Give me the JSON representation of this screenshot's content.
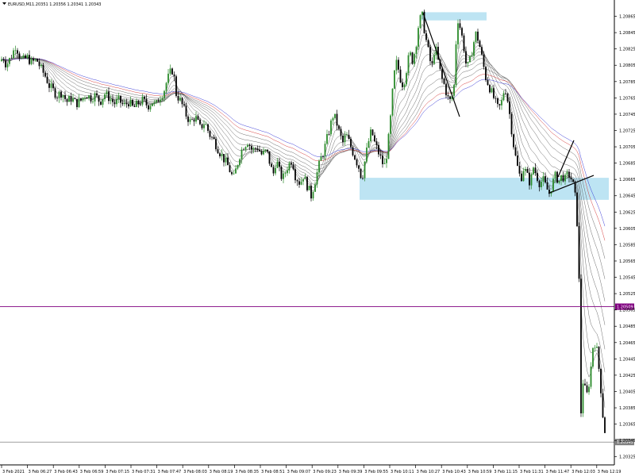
{
  "header": {
    "symbol": "EURUSD,M1",
    "ohlc": "1.20351 1.20356 1.20341 1.20343"
  },
  "chart_data": {
    "type": "candlestick",
    "symbol": "EURUSD",
    "timeframe": "M1",
    "ylim": [
      1.20315,
      1.20885
    ],
    "y_ticks": [
      "1.20865",
      "1.20845",
      "1.20825",
      "1.20805",
      "1.20785",
      "1.20765",
      "1.20745",
      "1.20725",
      "1.20705",
      "1.20685",
      "1.20665",
      "1.20645",
      "1.20625",
      "1.20605",
      "1.20585",
      "1.20565",
      "1.20545",
      "1.20525",
      "1.20505",
      "1.20485",
      "1.20465",
      "1.20445",
      "1.20425",
      "1.20405",
      "1.20385",
      "1.20365",
      "1.20345",
      "1.20325"
    ],
    "x_ticks": [
      "3 Feb 2021",
      "3 Feb 06:27",
      "3 Feb 06:43",
      "3 Feb 06:59",
      "3 Feb 07:15",
      "3 Feb 07:31",
      "3 Feb 07:47",
      "3 Feb 08:03",
      "3 Feb 08:19",
      "3 Feb 08:35",
      "3 Feb 08:51",
      "3 Feb 09:07",
      "3 Feb 09:23",
      "3 Feb 09:39",
      "3 Feb 09:55",
      "3 Feb 10:11",
      "3 Feb 10:27",
      "3 Feb 10:43",
      "3 Feb 10:59",
      "3 Feb 11:15",
      "3 Feb 11:31",
      "3 Feb 11:47",
      "3 Feb 12:03",
      "3 Feb 12:19"
    ],
    "price_path": [
      [
        0,
        1.2081
      ],
      [
        4,
        1.20815
      ],
      [
        8,
        1.20805
      ],
      [
        12,
        1.20812
      ],
      [
        16,
        1.2082
      ],
      [
        20,
        1.2083
      ],
      [
        24,
        1.20818
      ],
      [
        28,
        1.2081
      ],
      [
        34,
        1.20815
      ],
      [
        40,
        1.20808
      ],
      [
        46,
        1.20812
      ],
      [
        52,
        1.208
      ],
      [
        58,
        1.2079
      ],
      [
        62,
        1.2078
      ],
      [
        66,
        1.20775
      ],
      [
        72,
        1.20768
      ],
      [
        78,
        1.20772
      ],
      [
        84,
        1.2076
      ],
      [
        90,
        1.20765
      ],
      [
        96,
        1.20758
      ],
      [
        102,
        1.20762
      ],
      [
        108,
        1.2077
      ],
      [
        114,
        1.20765
      ],
      [
        120,
        1.20768
      ],
      [
        126,
        1.2076
      ],
      [
        132,
        1.2077
      ],
      [
        138,
        1.20765
      ],
      [
        144,
        1.20758
      ],
      [
        150,
        1.20762
      ],
      [
        156,
        1.20755
      ],
      [
        162,
        1.2076
      ],
      [
        168,
        1.20752
      ],
      [
        174,
        1.20758
      ],
      [
        180,
        1.20762
      ],
      [
        186,
        1.20755
      ],
      [
        192,
        1.2076
      ],
      [
        196,
        1.20755
      ],
      [
        200,
        1.20765
      ],
      [
        206,
        1.20772
      ],
      [
        210,
        1.20785
      ],
      [
        214,
        1.20795
      ],
      [
        218,
        1.208
      ],
      [
        222,
        1.2077
      ],
      [
        228,
        1.2076
      ],
      [
        234,
        1.20745
      ],
      [
        240,
        1.20735
      ],
      [
        246,
        1.20742
      ],
      [
        252,
        1.20728
      ],
      [
        258,
        1.20735
      ],
      [
        264,
        1.2072
      ],
      [
        270,
        1.20712
      ],
      [
        276,
        1.207
      ],
      [
        282,
        1.2069
      ],
      [
        288,
        1.2068
      ],
      [
        294,
        1.20665
      ],
      [
        298,
        1.2068
      ],
      [
        302,
        1.20695
      ],
      [
        306,
        1.20705
      ],
      [
        312,
        1.20712
      ],
      [
        318,
        1.207
      ],
      [
        324,
        1.20705
      ],
      [
        330,
        1.20695
      ],
      [
        336,
        1.207
      ],
      [
        340,
        1.20685
      ],
      [
        344,
        1.2067
      ],
      [
        348,
        1.2069
      ],
      [
        352,
        1.20675
      ],
      [
        356,
        1.20665
      ],
      [
        362,
        1.2068
      ],
      [
        368,
        1.2069
      ],
      [
        372,
        1.2067
      ],
      [
        378,
        1.2066
      ],
      [
        382,
        1.2067
      ],
      [
        388,
        1.20655
      ],
      [
        392,
        1.20645
      ],
      [
        396,
        1.2066
      ],
      [
        400,
        1.20675
      ],
      [
        404,
        1.2069
      ],
      [
        408,
        1.207
      ],
      [
        412,
        1.20715
      ],
      [
        416,
        1.2073
      ],
      [
        420,
        1.20745
      ],
      [
        424,
        1.20735
      ],
      [
        428,
        1.2072
      ],
      [
        432,
        1.2071
      ],
      [
        436,
        1.2072
      ],
      [
        440,
        1.2071
      ],
      [
        444,
        1.207
      ],
      [
        448,
        1.2069
      ],
      [
        452,
        1.2068
      ],
      [
        456,
        1.20665
      ],
      [
        460,
        1.2069
      ],
      [
        464,
        1.2071
      ],
      [
        468,
        1.20725
      ],
      [
        472,
        1.2071
      ],
      [
        476,
        1.207
      ],
      [
        480,
        1.2069
      ],
      [
        484,
        1.2068
      ],
      [
        488,
        1.207
      ],
      [
        492,
        1.2074
      ],
      [
        496,
        1.2079
      ],
      [
        500,
        1.2081
      ],
      [
        504,
        1.2079
      ],
      [
        508,
        1.2078
      ],
      [
        512,
        1.208
      ],
      [
        516,
        1.2082
      ],
      [
        520,
        1.2081
      ],
      [
        524,
        1.2083
      ],
      [
        528,
        1.2086
      ],
      [
        532,
        1.20865
      ],
      [
        536,
        1.2084
      ],
      [
        540,
        1.2082
      ],
      [
        544,
        1.208
      ],
      [
        548,
        1.2083
      ],
      [
        552,
        1.2081
      ],
      [
        556,
        1.2079
      ],
      [
        560,
        1.2078
      ],
      [
        564,
        1.20765
      ],
      [
        568,
        1.2076
      ],
      [
        572,
        1.2078
      ],
      [
        576,
        1.20865
      ],
      [
        580,
        1.2085
      ],
      [
        584,
        1.2083
      ],
      [
        588,
        1.208
      ],
      [
        592,
        1.2081
      ],
      [
        596,
        1.2083
      ],
      [
        600,
        1.20845
      ],
      [
        604,
        1.2083
      ],
      [
        608,
        1.2081
      ],
      [
        612,
        1.2079
      ],
      [
        616,
        1.2078
      ],
      [
        620,
        1.2077
      ],
      [
        624,
        1.2076
      ],
      [
        628,
        1.2075
      ],
      [
        632,
        1.2076
      ],
      [
        636,
        1.2078
      ],
      [
        640,
        1.2076
      ],
      [
        644,
        1.2073
      ],
      [
        648,
        1.207
      ],
      [
        652,
        1.2068
      ],
      [
        656,
        1.20665
      ],
      [
        660,
        1.2068
      ],
      [
        664,
        1.2067
      ],
      [
        668,
        1.2066
      ],
      [
        672,
        1.2068
      ],
      [
        676,
        1.2067
      ],
      [
        680,
        1.2066
      ],
      [
        684,
        1.20665
      ],
      [
        688,
        1.20655
      ],
      [
        692,
        1.20648
      ],
      [
        696,
        1.2066
      ],
      [
        700,
        1.2067
      ],
      [
        704,
        1.20662
      ],
      [
        708,
        1.2067
      ],
      [
        712,
        1.20665
      ],
      [
        716,
        1.20672
      ],
      [
        720,
        1.20665
      ],
      [
        724,
        1.2065
      ],
      [
        728,
        1.206
      ],
      [
        730,
        1.2052
      ],
      [
        732,
        1.2038
      ],
      [
        734,
        1.2042
      ],
      [
        736,
        1.2041
      ],
      [
        740,
        1.204
      ],
      [
        744,
        1.2043
      ],
      [
        748,
        1.2047
      ],
      [
        752,
        1.20455
      ],
      [
        756,
        1.2042
      ],
      [
        760,
        1.2037
      ],
      [
        764,
        1.20343
      ]
    ],
    "ribbon_offsets": [
      0.0,
      1.8e-05,
      3.6e-05,
      5.4e-05,
      7.2e-05,
      9e-05,
      0.000108,
      0.000126,
      0.000144
    ],
    "ribbon_colors": {
      "fast": "#555555",
      "red": "#d02020",
      "blue": "#2020d0"
    },
    "zones": [
      {
        "from": [
          531,
          1.2087
        ],
        "to": [
          613,
          1.2086
        ]
      },
      {
        "from": [
          453,
          1.20667
        ],
        "to": [
          767,
          1.2064
        ]
      }
    ],
    "trendlines": [
      {
        "from": [
          533,
          1.20869
        ],
        "to": [
          579,
          1.20742
        ]
      },
      {
        "from": [
          691,
          1.20648
        ],
        "to": [
          748,
          1.2067
        ]
      },
      {
        "from": [
          703,
          1.20668
        ],
        "to": [
          723,
          1.20713
        ]
      }
    ],
    "hlines": [
      {
        "price": 1.20509,
        "color": "#800080",
        "label": "1.20509"
      },
      {
        "price": 1.20343,
        "color": "#808080",
        "label": "1.20343"
      }
    ],
    "colors": {
      "up": "#2a8a2a",
      "down": "#000000",
      "zone": "#bde4f3"
    }
  }
}
